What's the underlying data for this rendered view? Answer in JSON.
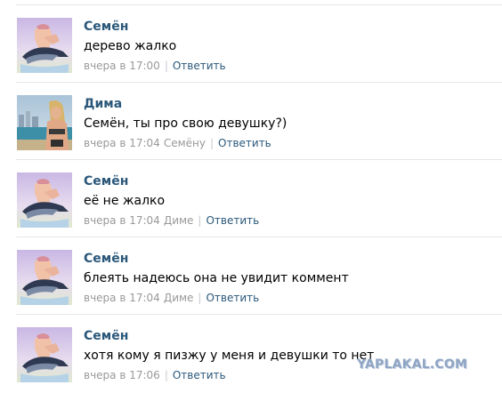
{
  "comments": [
    {
      "author": "Семён",
      "avatar": "dolphin-rider-avatar",
      "text": "дерево жалко",
      "time": "вчера в 17:00",
      "reply_to": "",
      "reply_label": "Ответить"
    },
    {
      "author": "Дима",
      "avatar": "woman-beach-avatar",
      "text": "Семён, ты про свою девушку?)",
      "time": "вчера в 17:04",
      "reply_to": "Семёну",
      "reply_label": "Ответить"
    },
    {
      "author": "Семён",
      "avatar": "dolphin-rider-avatar",
      "text": "её не жалко",
      "time": "вчера в 17:04",
      "reply_to": "Диме",
      "reply_label": "Ответить"
    },
    {
      "author": "Семён",
      "avatar": "dolphin-rider-avatar",
      "text": "блеять надеюсь она не увидит коммент",
      "time": "вчера в 17:04",
      "reply_to": "Диме",
      "reply_label": "Ответить"
    },
    {
      "author": "Семён",
      "avatar": "dolphin-rider-avatar",
      "text": "хотя кому я пизжу у меня и девушки то нет",
      "time": "вчера в 17:06",
      "reply_to": "",
      "reply_label": "Ответить"
    }
  ],
  "separator": "|",
  "watermark": "YAPLAKAL.COM",
  "colors": {
    "author": "#2b587a",
    "link": "#2b587a",
    "meta": "#999999",
    "divider": "#e3e6ea",
    "watermark": "#8fa5c4"
  }
}
